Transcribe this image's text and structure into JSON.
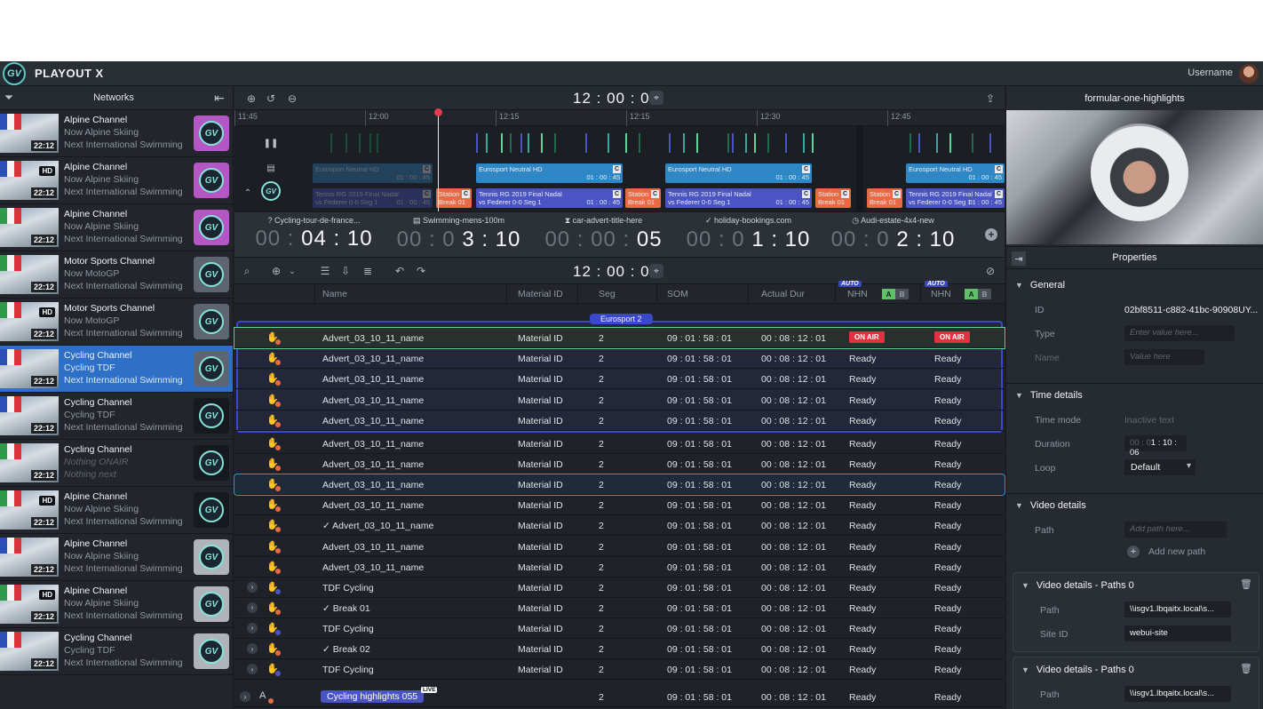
{
  "app": {
    "title": "PLAYOUT X",
    "logo": "GV",
    "username": "Username"
  },
  "sidebar": {
    "title": "Networks",
    "items": [
      {
        "channel": "Alpine Channel",
        "now": "Now Alpine Skiing",
        "next": "Next International Swimming",
        "time": "22:12",
        "hd": "",
        "flag": "france",
        "badge_color": "#b457c4"
      },
      {
        "channel": "Alpine Channel",
        "now": "Now Alpine Skiing",
        "next": "Next International Swimming",
        "time": "22:12",
        "hd": "HD",
        "flag": "france",
        "badge_color": "#b457c4"
      },
      {
        "channel": "Alpine Channel",
        "now": "Now Alpine Skiing",
        "next": "Next International Swimming",
        "time": "22:12",
        "hd": "",
        "flag": "italy",
        "badge_color": "#b457c4"
      },
      {
        "channel": "Motor Sports Channel",
        "now": "Now MotoGP",
        "next": "Next International Swimming",
        "time": "22:12",
        "hd": "",
        "flag": "italy",
        "badge_color": "#5c6570"
      },
      {
        "channel": "Motor Sports Channel",
        "now": "Now MotoGP",
        "next": "Next International Swimming",
        "time": "22:12",
        "hd": "HD",
        "flag": "italy",
        "badge_color": "#5c6570"
      },
      {
        "channel": "Cycling Channel",
        "now": "Cycling TDF",
        "next": "Next International Swimming",
        "time": "22:12",
        "hd": "",
        "flag": "france",
        "badge_color": "#5c6570",
        "selected": true
      },
      {
        "channel": "Cycling Channel",
        "now": "Cycling TDF",
        "next": "Next International Swimming",
        "time": "22:12",
        "hd": "",
        "flag": "france",
        "badge_color": "#16191d"
      },
      {
        "channel": "Cycling Channel",
        "now": "Nothing ONAIR",
        "next": "Nothing next",
        "time": "22:12",
        "hd": "",
        "flag": "italy",
        "badge_color": "#16191d",
        "dim": true
      },
      {
        "channel": "Alpine Channel",
        "now": "Now Alpine Skiing",
        "next": "Next International Swimming",
        "time": "22:12",
        "hd": "HD",
        "flag": "italy",
        "badge_color": "#16191d"
      },
      {
        "channel": "Alpine Channel",
        "now": "Now Alpine Skiing",
        "next": "Next International Swimming",
        "time": "22:12",
        "hd": "",
        "flag": "france",
        "badge_color": "#aeb4ba"
      },
      {
        "channel": "Alpine Channel",
        "now": "Now Alpine Skiing",
        "next": "Next International Swimming",
        "time": "22:12",
        "hd": "HD",
        "flag": "italy",
        "badge_color": "#aeb4ba"
      },
      {
        "channel": "Cycling Channel",
        "now": "Cycling TDF",
        "next": "Next International Swimming",
        "time": "22:12",
        "hd": "",
        "flag": "france",
        "badge_color": "#aeb4ba"
      }
    ]
  },
  "timeline": {
    "clock": "12 : 00 : 00",
    "ruler": [
      "11:45",
      "12:00",
      "12:15",
      "12:15",
      "12:30",
      "12:45"
    ],
    "segments": [
      {
        "label": "Eurosport Neutral HD",
        "time": "01 : 00 : 45"
      },
      {
        "label": "Tennis RG 2019 Final Nadal",
        "sub": "vs Federer 0-0 Seg 1",
        "time": "01 : 00 : 45"
      },
      {
        "label": "Station",
        "sub": "Break 01"
      }
    ]
  },
  "countdowns": [
    {
      "label": "Cycling-tour-de-france...",
      "grey": "00 :",
      "white": "04 : 10",
      "icon": "question-icon"
    },
    {
      "label": "Swimming-mens-100m",
      "grey": "00 : 0",
      "white": "3 : 10",
      "icon": "document-icon"
    },
    {
      "label": "car-advert-title-here",
      "grey": "00 : 00 :",
      "white": "05",
      "icon": "hourglass-icon"
    },
    {
      "label": "holiday-bookings.com",
      "grey": "00 : 0",
      "white": "1 : 10",
      "icon": "check-icon"
    },
    {
      "label": "Audi-estate-4x4-new",
      "grey": "00 : 0",
      "white": "2 : 10",
      "icon": "clock-icon"
    }
  ],
  "list": {
    "clock": "12 : 00 : 00",
    "headers": {
      "name": "Name",
      "material": "Material ID",
      "seg": "Seg",
      "som": "SOM",
      "dur": "Actual Dur",
      "nhn1": "NHN",
      "nhn2": "NHN",
      "auto": "AUTO",
      "a": "A",
      "b": "B"
    },
    "group_label": "Eurosport 2",
    "group_rows": [
      {
        "name": "Advert_03_10_11_name",
        "material": "Material ID",
        "seg": "2",
        "som": "09 : 01 : 58 : 01",
        "dur": "00 : 08 : 12 : 01",
        "s1": "ON AIR",
        "s2": "ON AIR",
        "onair": true
      },
      {
        "name": "Advert_03_10_11_name",
        "material": "Material ID",
        "seg": "2",
        "som": "09 : 01 : 58 : 01",
        "dur": "00 : 08 : 12 : 01",
        "s1": "Ready",
        "s2": "Ready"
      },
      {
        "name": "Advert_03_10_11_name",
        "material": "Material ID",
        "seg": "2",
        "som": "09 : 01 : 58 : 01",
        "dur": "00 : 08 : 12 : 01",
        "s1": "Ready",
        "s2": "Ready"
      },
      {
        "name": "Advert_03_10_11_name",
        "material": "Material ID",
        "seg": "2",
        "som": "09 : 01 : 58 : 01",
        "dur": "00 : 08 : 12 : 01",
        "s1": "Ready",
        "s2": "Ready"
      },
      {
        "name": "Advert_03_10_11_name",
        "material": "Material ID",
        "seg": "2",
        "som": "09 : 01 : 58 : 01",
        "dur": "00 : 08 : 12 : 01",
        "s1": "Ready",
        "s2": "Ready"
      }
    ],
    "rows": [
      {
        "name": "Advert_03_10_11_name",
        "material": "Material ID",
        "seg": "2",
        "som": "09 : 01 : 58 : 01",
        "dur": "00 : 08 : 12 : 01",
        "s1": "Ready",
        "s2": "Ready"
      },
      {
        "name": "Advert_03_10_11_name",
        "material": "Material ID",
        "seg": "2",
        "som": "09 : 01 : 58 : 01",
        "dur": "00 : 08 : 12 : 01",
        "s1": "Ready",
        "s2": "Ready"
      },
      {
        "name": "Advert_03_10_11_name",
        "material": "Material ID",
        "seg": "2",
        "som": "09 : 01 : 58 : 01",
        "dur": "00 : 08 : 12 : 01",
        "s1": "Ready",
        "s2": "Ready",
        "selected": true
      },
      {
        "name": "Advert_03_10_11_name",
        "material": "Material ID",
        "seg": "2",
        "som": "09 : 01 : 58 : 01",
        "dur": "00 : 08 : 12 : 01",
        "s1": "Ready",
        "s2": "Ready"
      },
      {
        "name": "✓ Advert_03_10_11_name",
        "material": "Material ID",
        "seg": "2",
        "som": "09 : 01 : 58 : 01",
        "dur": "00 : 08 : 12 : 01",
        "s1": "Ready",
        "s2": "Ready"
      },
      {
        "name": "Advert_03_10_11_name",
        "material": "Material ID",
        "seg": "2",
        "som": "09 : 01 : 58 : 01",
        "dur": "00 : 08 : 12 : 01",
        "s1": "Ready",
        "s2": "Ready"
      },
      {
        "name": "Advert_03_10_11_name",
        "material": "Material ID",
        "seg": "2",
        "som": "09 : 01 : 58 : 01",
        "dur": "00 : 08 : 12 : 01",
        "s1": "Ready",
        "s2": "Ready"
      },
      {
        "name": "TDF Cycling",
        "material": "Material ID",
        "seg": "2",
        "som": "09 : 01 : 58 : 01",
        "dur": "00 : 08 : 12 : 01",
        "s1": "Ready",
        "s2": "Ready",
        "expand": true,
        "prog": true
      },
      {
        "name": "✓ Break 01",
        "material": "Material ID",
        "seg": "2",
        "som": "09 : 01 : 58 : 01",
        "dur": "00 : 08 : 12 : 01",
        "s1": "Ready",
        "s2": "Ready",
        "expand": true
      },
      {
        "name": "TDF Cycling",
        "material": "Material ID",
        "seg": "2",
        "som": "09 : 01 : 58 : 01",
        "dur": "00 : 08 : 12 : 01",
        "s1": "Ready",
        "s2": "Ready",
        "expand": true,
        "prog": true
      },
      {
        "name": "✓ Break 02",
        "material": "Material ID",
        "seg": "2",
        "som": "09 : 01 : 58 : 01",
        "dur": "00 : 08 : 12 : 01",
        "s1": "Ready",
        "s2": "Ready",
        "expand": true
      },
      {
        "name": "TDF Cycling",
        "material": "Material ID",
        "seg": "2",
        "som": "09 : 01 : 58 : 01",
        "dur": "00 : 08 : 12 : 01",
        "s1": "Ready",
        "s2": "Ready",
        "expand": true,
        "prog": true
      }
    ],
    "last_row": {
      "name": "Cycling highlights 055",
      "live": "LIVE",
      "seg": "2",
      "som": "09 : 01 : 58 : 01",
      "dur": "00 : 08 : 12 : 01",
      "s1": "Ready",
      "s2": "Ready"
    }
  },
  "preview": {
    "title": "formular-one-highlights"
  },
  "properties": {
    "title": "Properties",
    "general": {
      "title": "General",
      "id_label": "ID",
      "id_value": "02bf8511-c882-41bc-90908UY...",
      "type_label": "Type",
      "type_placeholder": "Enter value here...",
      "name_label": "Name",
      "name_placeholder": "Value here"
    },
    "time": {
      "title": "Time details",
      "mode_label": "Time mode",
      "mode_value": "Inactive text",
      "duration_label": "Duration",
      "duration_grey": "00 : 0",
      "duration_value": "1 : 10 : 06",
      "loop_label": "Loop",
      "loop_value": "Default"
    },
    "video": {
      "title": "Video details",
      "path_label": "Path",
      "path_placeholder": "Add path here...",
      "add_label": "Add new path"
    },
    "cards": [
      {
        "title": "Video details - Paths 0",
        "path_label": "Path",
        "path_value": "\\\\isgv1.lbqaitx.local\\s...",
        "site_label": "Site ID",
        "site_value": "webui-site"
      },
      {
        "title": "Video details - Paths 0",
        "path_label": "Path",
        "path_value": "\\\\isgv1.lbqaitx.local\\s..."
      }
    ]
  }
}
